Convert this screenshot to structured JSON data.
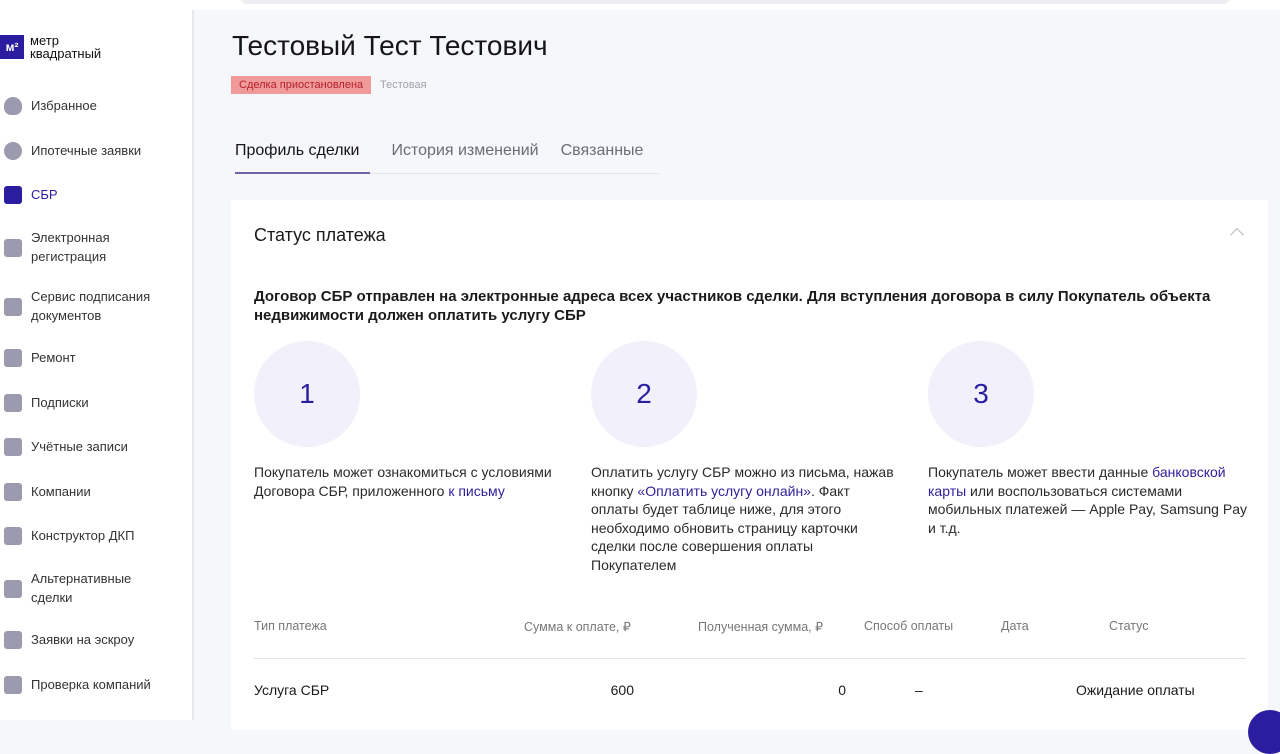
{
  "logo": {
    "mark": "м²",
    "line1": "метр",
    "line2": "квадратный"
  },
  "sidebar": {
    "items": [
      {
        "label": "Избранное",
        "icon": "heart-icon"
      },
      {
        "label": "Ипотечные заявки",
        "icon": "percent-icon"
      },
      {
        "label": "СБР",
        "icon": "lock-icon",
        "active": true
      },
      {
        "label": "Электронная регистрация",
        "icon": "folder-icon"
      },
      {
        "label": "Сервис подписания документов",
        "icon": "document-sign-icon"
      },
      {
        "label": "Ремонт",
        "icon": "paint-roller-icon"
      },
      {
        "label": "Подписки",
        "icon": "bookmark-icon"
      },
      {
        "label": "Учётные записи",
        "icon": "grid-icon"
      },
      {
        "label": "Компании",
        "icon": "companies-icon"
      },
      {
        "label": "Конструктор ДКП",
        "icon": "document-sign-icon"
      },
      {
        "label": "Альтернативные сделки",
        "icon": "document-sign-icon"
      },
      {
        "label": "Заявки на эскроу",
        "icon": "safe-icon"
      },
      {
        "label": "Проверка компаний",
        "icon": "check-icon"
      }
    ]
  },
  "header": {
    "title": "Тестовый Тест Тестович",
    "badge": "Сделка приостановлена",
    "subtitle": "Тестовая"
  },
  "tabs": [
    "Профиль сделки",
    "История изменений",
    "Связанные"
  ],
  "card": {
    "title": "Статус платежа",
    "lead": "Договор СБР отправлен на электронные адреса всех участников сделки. Для вступления договора в силу Покупатель объекта недвижимости должен оплатить услугу СБР",
    "steps": [
      {
        "num": "1",
        "pre": "Покупатель может ознакомиться с условиями Договора СБР, приложенного ",
        "link": "к письму",
        "post": ""
      },
      {
        "num": "2",
        "pre": "Оплатить услугу СБР можно из письма, нажав кнопку ",
        "link": "«Оплатить услугу онлайн»",
        "post": ". Факт оплаты будет таблице ниже, для этого необходимо обновить страницу карточки сделки после совершения оплаты Покупателем"
      },
      {
        "num": "3",
        "pre": "Покупатель может ввести данные ",
        "link": "банковской карты",
        "post": " или воспользоваться системами мобильных платежей — Apple Pay, Samsung Pay и т.д."
      }
    ]
  },
  "table": {
    "headers": [
      "Тип платежа",
      "Сумма к оплате, ₽",
      "Полученная сумма, ₽",
      "Способ оплаты",
      "Дата",
      "Статус"
    ],
    "rows": [
      [
        "Услуга СБР",
        "600",
        "0",
        "–",
        "",
        "Ожидание оплаты"
      ]
    ]
  }
}
